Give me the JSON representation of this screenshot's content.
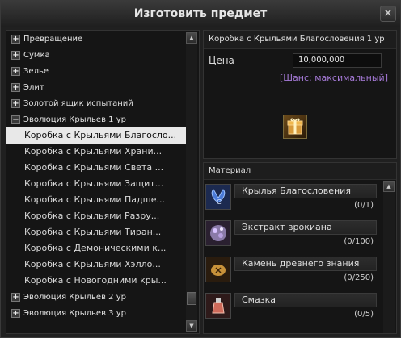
{
  "window": {
    "title": "Изготовить предмет",
    "close_label": "×"
  },
  "tree": {
    "categories_top": [
      {
        "label": "Превращение",
        "toggle": "+"
      },
      {
        "label": "Сумка",
        "toggle": "+"
      },
      {
        "label": "Зелье",
        "toggle": "+"
      },
      {
        "label": "Элит",
        "toggle": "+"
      },
      {
        "label": "Золотой ящик испытаний",
        "toggle": "+"
      },
      {
        "label": "Эволюция Крыльев 1 ур",
        "toggle": "−"
      }
    ],
    "items": [
      "Коробка с Крыльями Благосло...",
      "Коробка с Крыльями Храни...",
      "Коробка с Крыльями Света ...",
      "Коробка с Крыльями Защит...",
      "Коробка с Крыльями Падше...",
      "Коробка с Крыльями Разру...",
      "Коробка с Крыльями Тиран...",
      "Коробка с Демоническими к...",
      "Коробка с Крыльями Хэлло...",
      "Коробка с Новогодними кры..."
    ],
    "categories_bottom": [
      {
        "label": "Эволюция Крыльев 2 ур",
        "toggle": "+"
      },
      {
        "label": "Эволюция Крыльев 3 ур",
        "toggle": "+"
      }
    ],
    "selected_index": 0,
    "scroll_up": "▲",
    "scroll_down": "▼"
  },
  "product": {
    "name": "Коробка с Крыльями Благословения 1 ур",
    "price_label": "Цена",
    "price_value": "10,000,000",
    "chance": "[Шанс: максимальный]",
    "icon": "gift-box-icon"
  },
  "materials": {
    "header": "Материал",
    "list": [
      {
        "name": "Крылья Благословения",
        "count": "(0/1)",
        "icon": "wings-icon",
        "color": "#2a3b6a"
      },
      {
        "name": "Экстракт врокиана",
        "count": "(0/100)",
        "icon": "crystal-icon",
        "color": "#6a5a7a"
      },
      {
        "name": "Камень древнего знания",
        "count": "(0/250)",
        "icon": "rune-stone-icon",
        "color": "#6a4a1a"
      },
      {
        "name": "Смазка",
        "count": "(0/5)",
        "icon": "potion-icon",
        "color": "#7a3a3a"
      }
    ]
  }
}
